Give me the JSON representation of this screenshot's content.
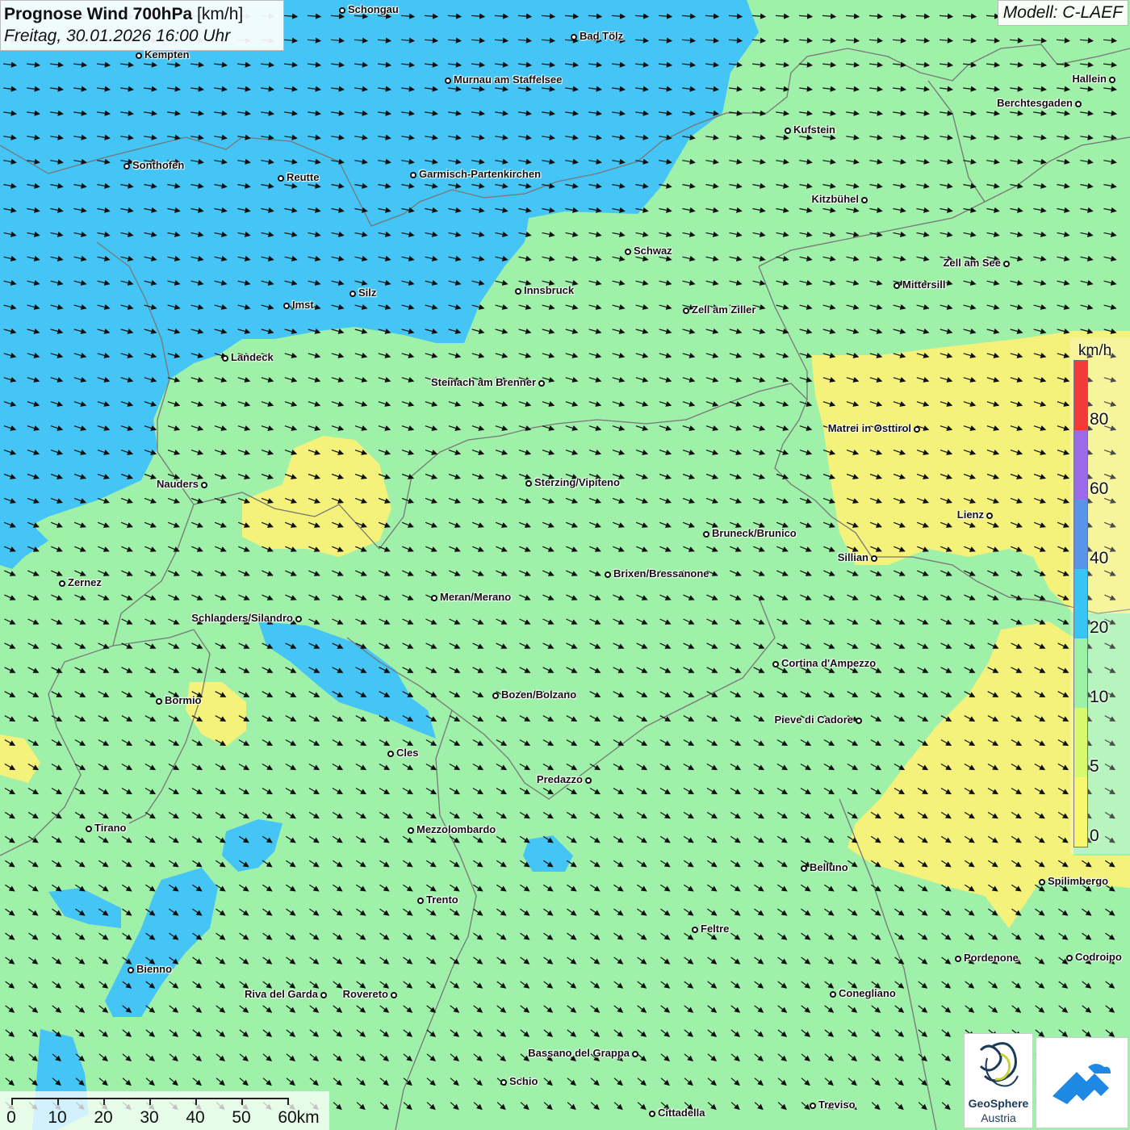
{
  "title": {
    "main": "Prognose Wind 700hPa",
    "unit": "[km/h]",
    "date": "Freitag, 30.01.2026 16:00 Uhr",
    "model": "Modell: C-LAEF"
  },
  "legend": {
    "unit": "km/h",
    "labels": [
      "0",
      "5",
      "10",
      "20",
      "40",
      "60",
      "80"
    ],
    "colors": [
      "#f8f870",
      "#d8f870",
      "#9cf0a8",
      "#38c4f4",
      "#5a94e8",
      "#9b6ae8",
      "#f23a3a"
    ]
  },
  "scale_bar": {
    "labels": [
      "0",
      "10",
      "20",
      "30",
      "40",
      "50",
      "60km"
    ]
  },
  "map_colors": {
    "calm": "#f4f27a",
    "light": "#9ff0a8",
    "moderate": "#44c5f5",
    "strong": "#5c9be8",
    "border": "#777777",
    "arrow": "#111111"
  },
  "cities": [
    {
      "name": "Schongau"
    },
    {
      "name": "Bad Tölz"
    },
    {
      "name": "Kempten"
    },
    {
      "name": "Murnau am Staffelsee"
    },
    {
      "name": "Hallein"
    },
    {
      "name": "Berchtesgaden"
    },
    {
      "name": "Kufstein"
    },
    {
      "name": "Sonthofen"
    },
    {
      "name": "Reutte"
    },
    {
      "name": "Garmisch-Partenkirchen"
    },
    {
      "name": "Kitzbühel"
    },
    {
      "name": "Schwaz"
    },
    {
      "name": "Zell am See"
    },
    {
      "name": "Mittersill"
    },
    {
      "name": "Innsbruck"
    },
    {
      "name": "Silz"
    },
    {
      "name": "Imst"
    },
    {
      "name": "Zell am Ziller"
    },
    {
      "name": "Landeck"
    },
    {
      "name": "Steinach am Brenner"
    },
    {
      "name": "Matrei in Osttirol"
    },
    {
      "name": "Nauders"
    },
    {
      "name": "Sterzing/Vipiteno"
    },
    {
      "name": "Lienz"
    },
    {
      "name": "Bruneck/Brunico"
    },
    {
      "name": "Sillian"
    },
    {
      "name": "Zernez"
    },
    {
      "name": "Brixen/Bressanone"
    },
    {
      "name": "Meran/Merano"
    },
    {
      "name": "Schlanders/Silandro"
    },
    {
      "name": "Cortina d'Ampezzo"
    },
    {
      "name": "Bozen/Bolzano"
    },
    {
      "name": "Bormio"
    },
    {
      "name": "Pieve di Cadore"
    },
    {
      "name": "Cles"
    },
    {
      "name": "Predazzo"
    },
    {
      "name": "Tirano"
    },
    {
      "name": "Mezzolombardo"
    },
    {
      "name": "Belluno"
    },
    {
      "name": "Spilimbergo"
    },
    {
      "name": "Trento"
    },
    {
      "name": "Feltre"
    },
    {
      "name": "Bienno"
    },
    {
      "name": "Pordenone"
    },
    {
      "name": "Codroipo"
    },
    {
      "name": "Riva del Garda"
    },
    {
      "name": "Rovereto"
    },
    {
      "name": "Conegliano"
    },
    {
      "name": "Bassano del Grappa"
    },
    {
      "name": "Schio"
    },
    {
      "name": "Treviso"
    },
    {
      "name": "Cittadella"
    }
  ],
  "logos": {
    "geosphere_line1": "GeoSphere",
    "geosphere_line2": "Austria"
  }
}
